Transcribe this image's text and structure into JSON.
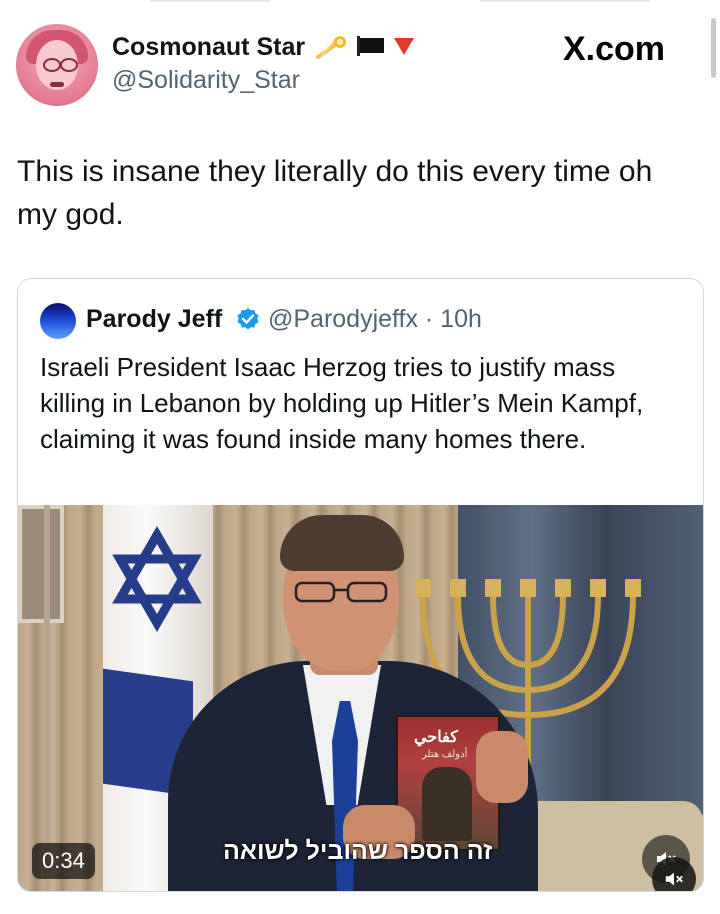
{
  "author": {
    "display_name": "Cosmonaut Star",
    "handle": "@Solidarity_Star",
    "name_icons": [
      "comet-icon",
      "black-flag-icon",
      "red-triangle-icon"
    ]
  },
  "brand": "X.com",
  "tweet_text": "This is insane they literally do this every time oh my god.",
  "quoted": {
    "display_name": "Parody Jeff",
    "handle_time": "@Parodyjeffx · 10h",
    "text": "Israeli President Isaac Herzog tries to justify mass killing in Lebanon by holding up Hitler’s Mein Kampf, claiming it was found inside many homes there.",
    "video": {
      "duration": "0:34",
      "caption": "זה הספר שהוביל לשואה",
      "book_title": "كفاحي",
      "book_author": "أدولف هتلر"
    }
  },
  "colors": {
    "text": "#0f1419",
    "secondary": "#536471",
    "verified": "#1d9bf0",
    "border": "#cfd9de"
  }
}
